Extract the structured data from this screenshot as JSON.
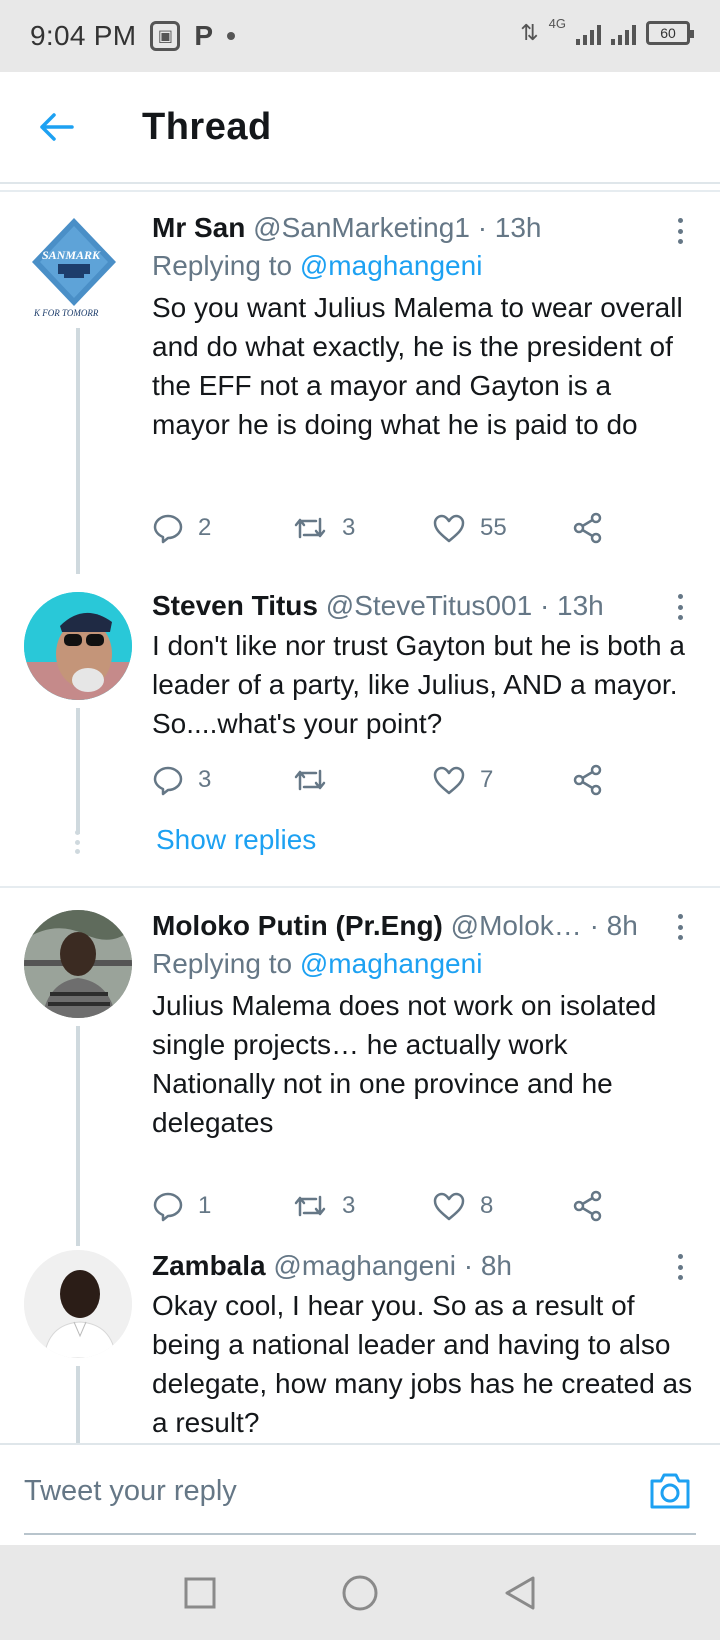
{
  "status_bar": {
    "time": "9:04 PM",
    "network": "4G",
    "battery": "60"
  },
  "header": {
    "title": "Thread"
  },
  "tweets": [
    {
      "name": "Mr San",
      "handle": "@SanMarketing1",
      "time": "· 13h",
      "replying_prefix": "Replying to ",
      "replying_to": "@maghangeni",
      "text": "So you want Julius Malema to wear overall and do what exactly, he is the president of the EFF not a mayor and Gayton is a mayor he is doing what he is paid to do",
      "replies": "2",
      "retweets": "3",
      "likes": "55",
      "avatar_text": "SANMARK",
      "avatar_tagline": "K FOR TOMORR"
    },
    {
      "name": "Steven Titus",
      "handle": "@SteveTitus001",
      "time": "· 13h",
      "text": "I don't like nor trust Gayton but he is both a leader of a party, like Julius, AND a mayor. So....what's your point?",
      "replies": "3",
      "retweets": "",
      "likes": "7"
    },
    {
      "name": "Moloko Putin (Pr.Eng)",
      "handle": "@Molok…",
      "time": "· 8h",
      "replying_prefix": "Replying to ",
      "replying_to": "@maghangeni",
      "text": "Julius Malema does not work on isolated single projects… he actually work Nationally not in one province and he delegates",
      "replies": "1",
      "retweets": "3",
      "likes": "8"
    },
    {
      "name": "Zambala",
      "handle": "@maghangeni",
      "time": "· 8h",
      "text": "Okay cool, I hear you. So as a result of being a national leader and having to also delegate,  how many jobs has he created as a result?"
    }
  ],
  "show_replies_label": "Show replies",
  "composer": {
    "placeholder": "Tweet your reply"
  },
  "colors": {
    "accent": "#1da1f2",
    "secondary_text": "#657786",
    "primary_text": "#14171a"
  }
}
